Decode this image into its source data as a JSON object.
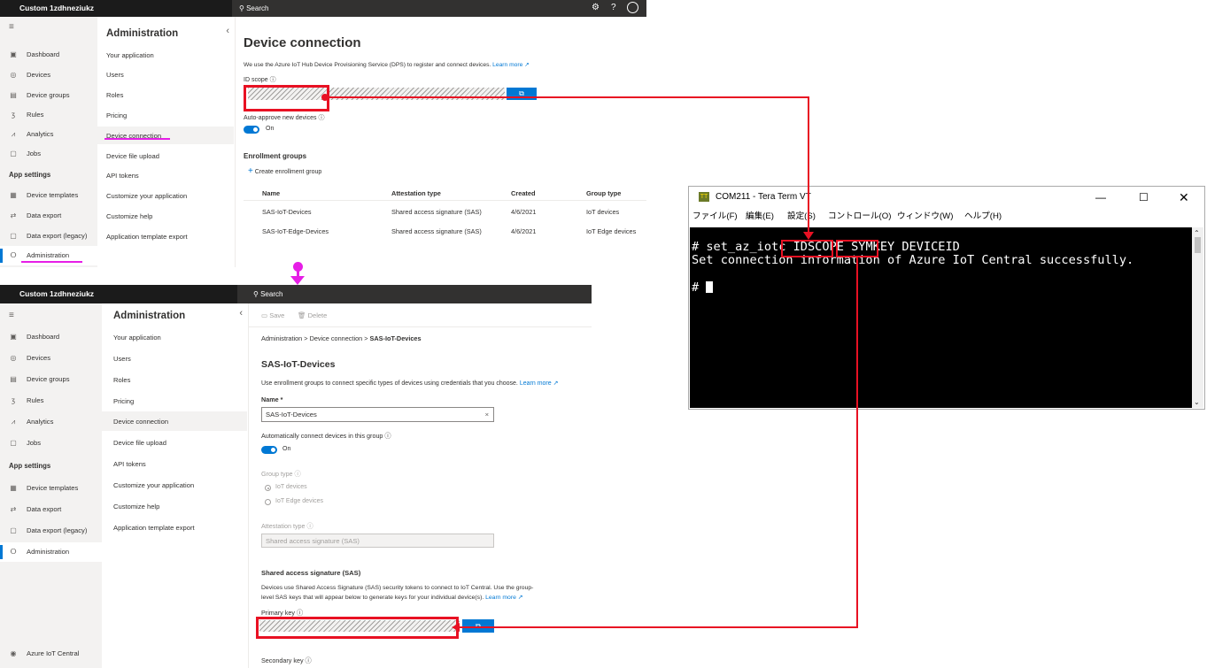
{
  "app_title": "Custom 1zdhneziukz",
  "search_label": "Search",
  "nav": {
    "items": [
      {
        "icon": "dashboard-icon",
        "glyph": "▣",
        "label": "Dashboard"
      },
      {
        "icon": "devices-icon",
        "glyph": "◎",
        "label": "Devices"
      },
      {
        "icon": "device-groups-icon",
        "glyph": "▤",
        "label": "Device groups"
      },
      {
        "icon": "rules-icon",
        "glyph": "ⳅ",
        "label": "Rules"
      },
      {
        "icon": "analytics-icon",
        "glyph": "⩘",
        "label": "Analytics"
      },
      {
        "icon": "jobs-icon",
        "glyph": "▢",
        "label": "Jobs"
      }
    ],
    "settings_header": "App settings",
    "settings_items": [
      {
        "icon": "device-templates-icon",
        "glyph": "▦",
        "label": "Device templates"
      },
      {
        "icon": "data-export-icon",
        "glyph": "⇄",
        "label": "Data export"
      },
      {
        "icon": "data-export-legacy-icon",
        "glyph": "▢",
        "label": "Data export (legacy)"
      },
      {
        "icon": "administration-icon",
        "glyph": "ⵔ",
        "label": "Administration"
      }
    ],
    "footer": "Azure IoT Central"
  },
  "admin_menu": {
    "title": "Administration",
    "items": [
      "Your application",
      "Users",
      "Roles",
      "Pricing",
      "Device connection",
      "Device file upload",
      "API tokens",
      "Customize your application",
      "Customize help",
      "Application template export"
    ]
  },
  "top_panel": {
    "heading": "Device connection",
    "description": "We use the Azure IoT Hub Device Provisioning Service (DPS) to register and connect devices.",
    "learn_more": "Learn more",
    "id_scope_label": "ID scope",
    "auto_approve_label": "Auto-approve new devices",
    "toggle_state": "On",
    "enrollment_heading": "Enrollment groups",
    "create_group": "Create enrollment group",
    "table": {
      "headers": [
        "Name",
        "Attestation type",
        "Created",
        "Group type"
      ],
      "rows": [
        [
          "SAS-IoT-Devices",
          "Shared access signature (SAS)",
          "4/6/2021",
          "IoT devices"
        ],
        [
          "SAS-IoT-Edge-Devices",
          "Shared access signature (SAS)",
          "4/6/2021",
          "IoT Edge devices"
        ]
      ]
    }
  },
  "bottom_panel": {
    "save": "Save",
    "delete": "Delete",
    "breadcrumb": [
      "Administration",
      "Device connection",
      "SAS-IoT-Devices"
    ],
    "heading": "SAS-IoT-Devices",
    "description": "Use enrollment groups to connect specific types of devices using credentials that you choose.",
    "learn_more": "Learn more",
    "name_label": "Name *",
    "name_value": "SAS-IoT-Devices",
    "auto_connect_label": "Automatically connect devices in this group",
    "toggle_state": "On",
    "group_type_label": "Group type",
    "group_type_options": [
      "IoT devices",
      "IoT Edge devices"
    ],
    "attestation_label": "Attestation type",
    "attestation_value": "Shared access signature (SAS)",
    "sas_heading": "Shared access signature (SAS)",
    "sas_desc_1": "Devices use Shared Access Signature (SAS) security tokens to connect to IoT Central. Use the group-",
    "sas_desc_2": "level SAS keys that will appear below to generate keys for your individual device(s).",
    "primary_key_label": "Primary key",
    "secondary_key_label": "Secondary key"
  },
  "terminal": {
    "title": "COM211 - Tera Term VT",
    "menu": [
      "ファイル(F)",
      "編集(E)",
      "設定(S)",
      "コントロール(O)",
      "ウィンドウ(W)",
      "ヘルプ(H)"
    ],
    "cmd": "# set_az_iotc",
    "arg1": "IDSCOPE",
    "arg2": "SYMKEY",
    "arg3": "DEVICEID",
    "output": "Set connection information of Azure IoT Central successfully.",
    "prompt": "#"
  },
  "colors": {
    "accent": "#0078d4",
    "highlight_red": "#e81123",
    "marker_magenta": "#e61ee6"
  }
}
